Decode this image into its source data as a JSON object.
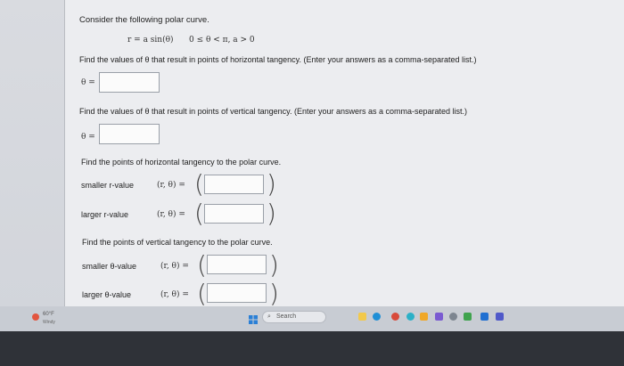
{
  "problem": {
    "intro": "Consider the following polar curve.",
    "equation": "r = a sin(θ)",
    "condition": "0 ≤ θ < π, a > 0"
  },
  "q1": {
    "prompt": "Find the values of θ that result in points of horizontal tangency. (Enter your answers as a comma-separated list.)",
    "label": "θ =",
    "value": ""
  },
  "q2": {
    "prompt": "Find the values of θ that result in points of vertical tangency. (Enter your answers as a comma-separated list.)",
    "label": "θ =",
    "value": ""
  },
  "q3": {
    "prompt": "Find the points of horizontal tangency to the polar curve.",
    "rows": [
      {
        "label": "smaller r-value",
        "eq": "(r, θ) =",
        "value": ""
      },
      {
        "label": "larger r-value",
        "eq": "(r, θ) =",
        "value": ""
      }
    ]
  },
  "q4": {
    "prompt": "Find the points of vertical tangency to the polar curve.",
    "rows": [
      {
        "label": "smaller θ-value",
        "eq": "(r, θ) =",
        "value": ""
      },
      {
        "label": "larger θ-value",
        "eq": "(r, θ) =",
        "value": ""
      }
    ]
  },
  "taskbar": {
    "weather_temp": "60°F",
    "weather_desc": "Windy",
    "search_label": "Search"
  }
}
